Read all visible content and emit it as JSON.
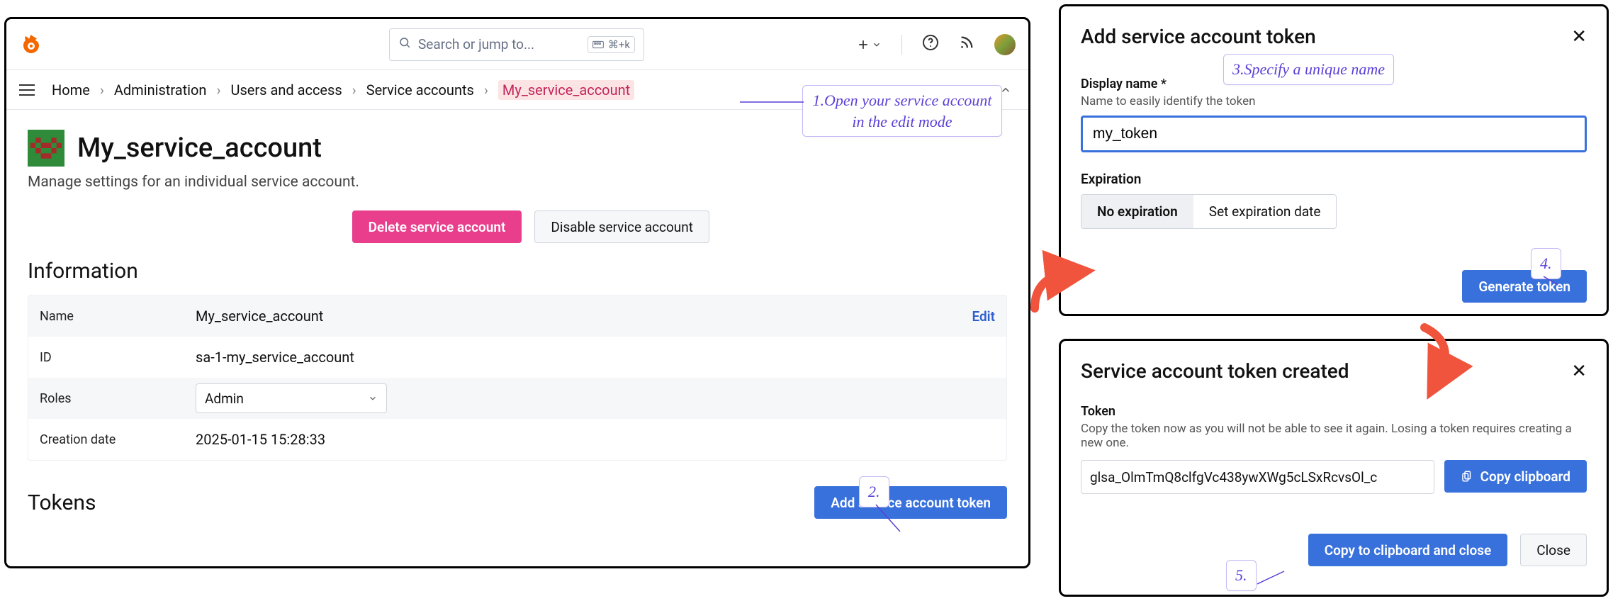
{
  "topbar": {
    "search_placeholder": "Search or jump to...",
    "kbd1": "⌘+k"
  },
  "breadcrumb": {
    "home": "Home",
    "admin": "Administration",
    "users_access": "Users and access",
    "service_accounts": "Service accounts",
    "current": "My_service_account"
  },
  "account": {
    "title": "My_service_account",
    "subtitle": "Manage settings for an individual service account.",
    "delete_btn": "Delete service account",
    "disable_btn": "Disable service account"
  },
  "sections": {
    "information": "Information",
    "tokens": "Tokens"
  },
  "info": {
    "name_label": "Name",
    "name_value": "My_service_account",
    "edit": "Edit",
    "id_label": "ID",
    "id_value": "sa-1-my_service_account",
    "roles_label": "Roles",
    "roles_value": "Admin",
    "created_label": "Creation date",
    "created_value": "2025-01-15 15:28:33"
  },
  "tokens": {
    "add_btn": "Add service account token"
  },
  "add_dialog": {
    "title": "Add service account token",
    "display_label": "Display name *",
    "display_hint": "Name to easily identify the token",
    "display_value": "my_token",
    "expiration_label": "Expiration",
    "no_expiration": "No expiration",
    "set_expiration": "Set expiration date",
    "generate_btn": "Generate token"
  },
  "created_dialog": {
    "title": "Service account token created",
    "token_label": "Token",
    "token_hint": "Copy the token now as you will not be able to see it again. Losing a token requires creating a new one.",
    "token_value": "glsa_OlmTmQ8clfgVc438ywXWg5cLSxRcvsOl_c",
    "copy_btn": "Copy clipboard",
    "copy_close_btn": "Copy to clipboard and close",
    "close_btn": "Close"
  },
  "callouts": {
    "c1": "1.Open your service account in the edit mode",
    "c2": "2.",
    "c3": "3.Specify a unique name",
    "c4": "4.",
    "c5": "5."
  }
}
